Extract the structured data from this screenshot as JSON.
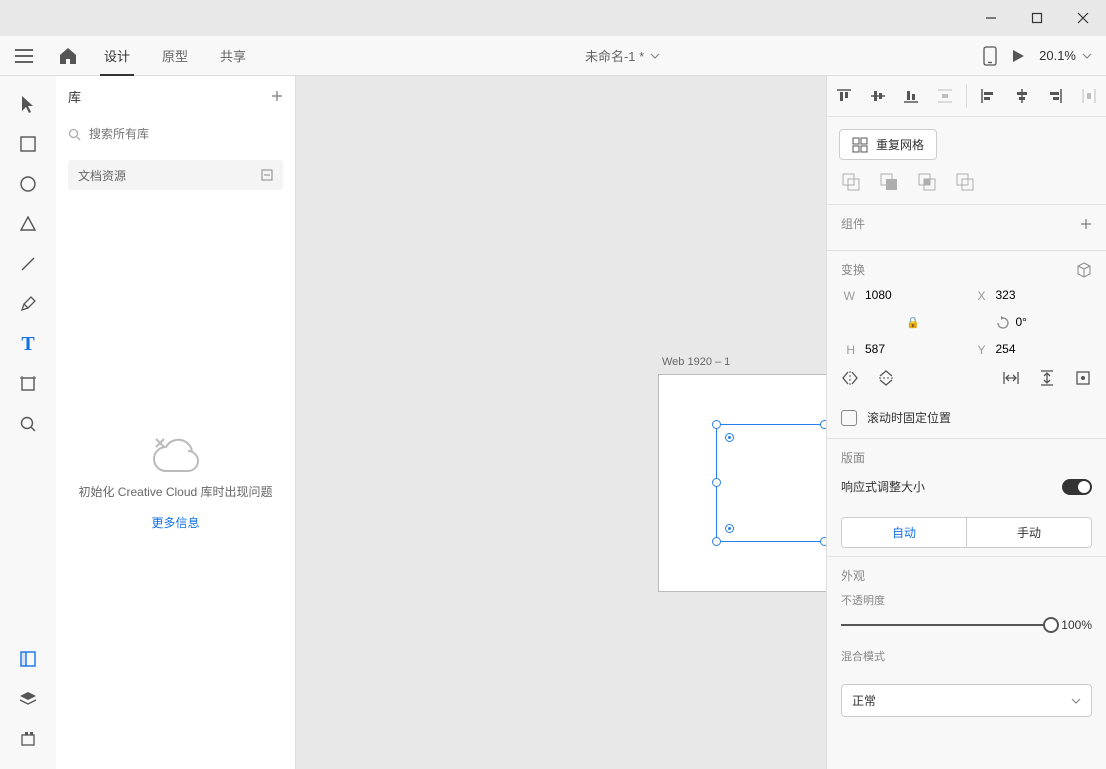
{
  "window": {
    "min": "—",
    "max": "□",
    "close": "✕"
  },
  "topnav": {
    "tabs": {
      "design": "设计",
      "prototype": "原型",
      "share": "共享"
    },
    "doc_title": "未命名-1 *",
    "zoom": "20.1%"
  },
  "library": {
    "title": "库",
    "search_placeholder": "搜索所有库",
    "section": "文档资源",
    "empty_msg": "初始化 Creative Cloud 库时出现问题",
    "more_info": "更多信息"
  },
  "canvas": {
    "artboard_name": "Web 1920 – 1"
  },
  "properties": {
    "repeat_grid": "重复网格",
    "components_label": "组件",
    "transform_label": "变换",
    "w": "1080",
    "x": "323",
    "h": "587",
    "y": "254",
    "rotation": "0°",
    "fix_scroll": "滚动时固定位置",
    "layout_label": "版面",
    "responsive_resize": "响应式调整大小",
    "auto": "自动",
    "manual": "手动",
    "appearance_label": "外观",
    "opacity_label": "不透明度",
    "opacity_value": "100%",
    "blend_label": "混合模式",
    "blend_value": "正常"
  }
}
